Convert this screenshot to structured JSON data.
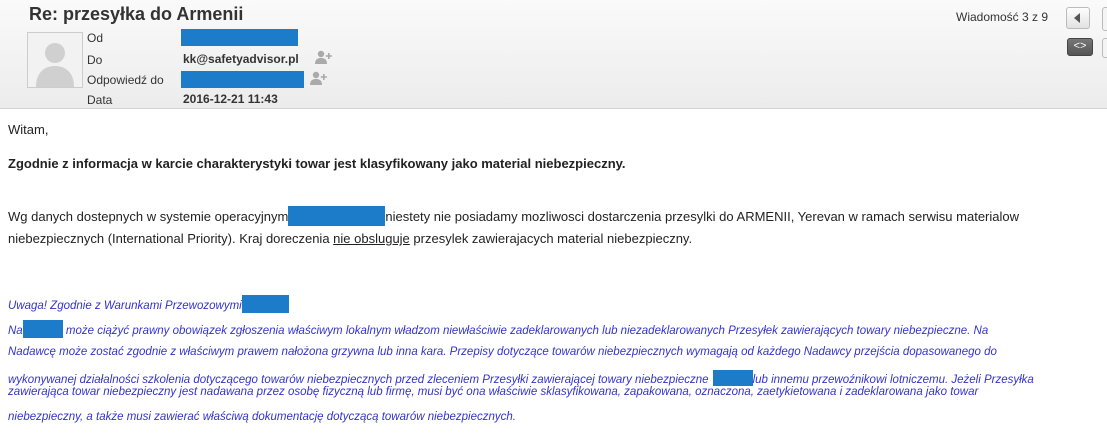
{
  "subject": "Re: przesyłka do Armenii",
  "counter": "Wiadomość 3 z 9",
  "headers": {
    "from_label": "Od",
    "to_label": "Do",
    "to_value": "kk@safetyadvisor.pl",
    "reply_label": "Odpowiedź do",
    "date_label": "Data",
    "date_value": "2016-12-21 11:43"
  },
  "body": {
    "greeting": "Witam,",
    "p1": "Zgodnie z informacja w karcie charakterystyki towar jest klasyfikowany jako material niebezpieczny.",
    "p2_a": "Wg danych dostepnych w systemie operacyjnym",
    "p2_b": "niestety nie posiadamy mozliwosci dostarczenia przesylki do ARMENII, Yerevan w ramach serwisu materialow",
    "p3_a": "niebezpiecznych (International Priority). Kraj doreczenia ",
    "p3_u": "nie obsluguje",
    "p3_b": " przesylek zawierajacych material niebezpieczny.",
    "n1": "Uwaga!  Zgodnie z Warunkami Przewozowymi",
    "n2_a": "Na",
    "n2_b": " może ciążyć prawny obowiązek zgłoszenia właściwym lokalnym władzom niewłaściwie zadeklarowanych lub niezadeklarowanych Przesyłek zawierających towary niebezpieczne. Na",
    "n3": "Nadawcę może zostać zgodnie z właściwym prawem nałożona grzywna lub inna kara. Przepisy dotyczące towarów niebezpiecznych wymagają od każdego Nadawcy przejścia dopasowanego do",
    "n4_a": "wykonywanej działalności szkolenia dotyczącego towarów niebezpiecznych przed zleceniem Przesyłki zawierającej towary niebezpieczne",
    "n4_b": "lub innemu przewoźnikowi lotniczemu. Jeżeli Przesyłka",
    "n5": "zawierająca towar niebezpieczny jest nadawana przez osobę fizyczną lub firmę, musi być ona właściwie sklasyfikowana, zapakowana, oznaczona, zaetykietowana i zadeklarowana jako towar",
    "n6": "niebezpieczny, a także musi zawierać właściwą dokumentację dotyczącą towarów niebezpiecznych."
  },
  "colors": {
    "redaction": "#1c7cc9",
    "notice_text": "#3333cc"
  },
  "icons": {
    "avatar": "person-silhouette",
    "add_contact": "add-contact-icon",
    "prev": "chevron-left-icon",
    "toggle": "code-toggle-icon"
  }
}
